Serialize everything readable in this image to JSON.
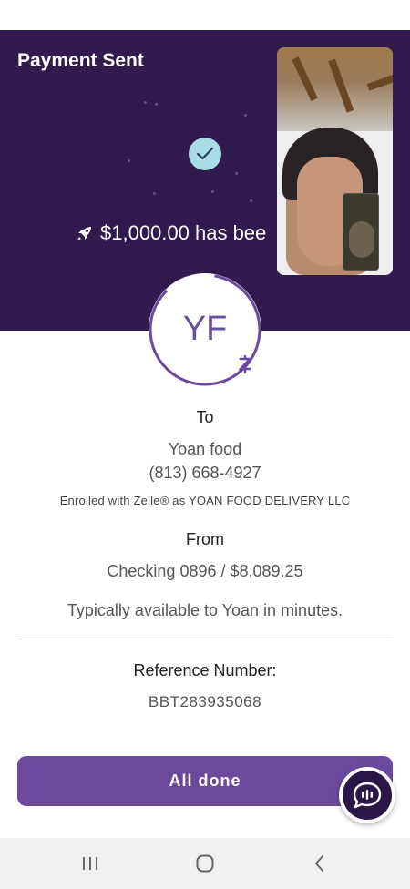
{
  "header": {
    "title": "Payment Sent",
    "sent_message": "$1,000.00 has bee",
    "background": "#301a4e",
    "check_color": "#a9dde6"
  },
  "recipient": {
    "initials": "YF",
    "to_label": "To",
    "name": "Yoan food",
    "phone": "(813) 668-4927",
    "enrolled_text": "Enrolled with Zelle® as YOAN FOOD DELIVERY LLC",
    "badge_symbol": "Z"
  },
  "source": {
    "from_label": "From",
    "account": "Checking 0896 / $8,089.25"
  },
  "availability_text": "Typically available to Yoan in minutes.",
  "reference": {
    "label": "Reference Number:",
    "number": "BBT283935068"
  },
  "actions": {
    "done_label": "All done",
    "accent": "#6b4a9e"
  },
  "icons": {
    "check": "checkmark-icon",
    "rocket": "rocket-icon",
    "chat": "chat-assistant-icon",
    "nav_recents": "recents-icon",
    "nav_home": "home-icon",
    "nav_back": "back-icon"
  }
}
